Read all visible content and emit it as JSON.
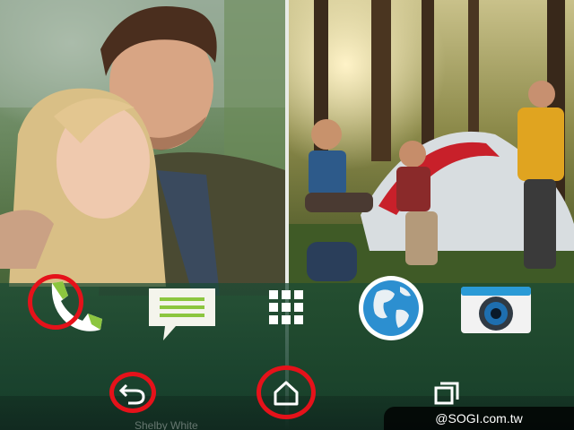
{
  "dock": {
    "apps": [
      {
        "name": "phone",
        "icon": "phone-icon"
      },
      {
        "name": "messages",
        "icon": "message-icon"
      },
      {
        "name": "all-apps",
        "icon": "app-grid-icon"
      },
      {
        "name": "browser",
        "icon": "globe-icon"
      },
      {
        "name": "camera",
        "icon": "camera-icon"
      }
    ]
  },
  "navbar": {
    "buttons": [
      {
        "name": "back",
        "icon": "back-icon"
      },
      {
        "name": "home",
        "icon": "home-icon"
      },
      {
        "name": "recent-apps",
        "icon": "recent-apps-icon"
      }
    ]
  },
  "highlights": [
    "phone",
    "back",
    "home"
  ],
  "colors": {
    "highlight_ring": "#e5121a",
    "dock_tint": "#1a4a34",
    "accent_green": "#8cc63f"
  },
  "watermark": {
    "text": "@SOGI.com.tw"
  },
  "notification_hint": {
    "text": "Shelby White"
  }
}
